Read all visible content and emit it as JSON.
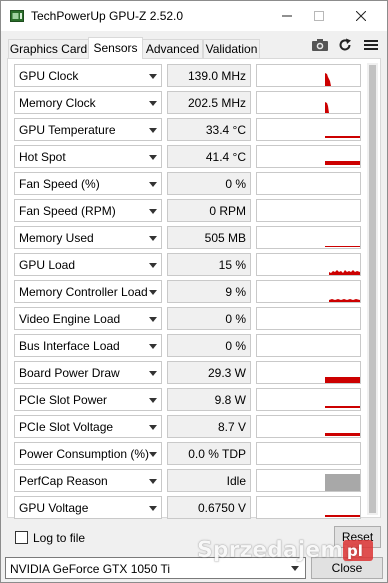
{
  "window": {
    "title": "TechPowerUp GPU-Z 2.52.0",
    "icon": "gpu-z-app-icon",
    "controls": [
      "minimize-icon",
      "maximize-icon",
      "close-icon"
    ]
  },
  "tabs": [
    {
      "label": "Graphics Card",
      "active": false
    },
    {
      "label": "Sensors",
      "active": true
    },
    {
      "label": "Advanced",
      "active": false
    },
    {
      "label": "Validation",
      "active": false
    }
  ],
  "toolbar": {
    "icons": [
      "camera-icon",
      "refresh-icon",
      "menu-icon"
    ]
  },
  "sensors": [
    {
      "label": "GPU Clock",
      "value": "139.0 MHz",
      "graph": "clock"
    },
    {
      "label": "Memory Clock",
      "value": "202.5 MHz",
      "graph": "memclock"
    },
    {
      "label": "GPU Temperature",
      "value": "33.4 °C",
      "graph": "temp"
    },
    {
      "label": "Hot Spot",
      "value": "41.4 °C",
      "graph": "hotspot"
    },
    {
      "label": "Fan Speed (%)",
      "value": "0 %",
      "graph": "none"
    },
    {
      "label": "Fan Speed (RPM)",
      "value": "0 RPM",
      "graph": "none"
    },
    {
      "label": "Memory Used",
      "value": "505 MB",
      "graph": "memused"
    },
    {
      "label": "GPU Load",
      "value": "15 %",
      "graph": "load"
    },
    {
      "label": "Memory Controller Load",
      "value": "9 %",
      "graph": "mcload"
    },
    {
      "label": "Video Engine Load",
      "value": "0 %",
      "graph": "none"
    },
    {
      "label": "Bus Interface Load",
      "value": "0 %",
      "graph": "none"
    },
    {
      "label": "Board Power Draw",
      "value": "29.3 W",
      "graph": "power"
    },
    {
      "label": "PCIe Slot Power",
      "value": "9.8 W",
      "graph": "slotpower"
    },
    {
      "label": "PCIe Slot Voltage",
      "value": "8.7 V",
      "graph": "slotvolt"
    },
    {
      "label": "Power Consumption (%)",
      "value": "0.0 % TDP",
      "graph": "none"
    },
    {
      "label": "PerfCap Reason",
      "value": "Idle",
      "graph": "perfcap"
    },
    {
      "label": "GPU Voltage",
      "value": "0.6750 V",
      "graph": "voltage"
    }
  ],
  "colors": {
    "graph_red": "#cc0000",
    "perfcap_gray": "#a8a8a8"
  },
  "footer": {
    "log_label": "Log to file",
    "log_checked": false,
    "reset_label": "Reset",
    "gpu_selected": "NVIDIA GeForce GTX 1050 Ti",
    "close_label": "Close"
  },
  "watermark": "Sprzedajemy.pl"
}
